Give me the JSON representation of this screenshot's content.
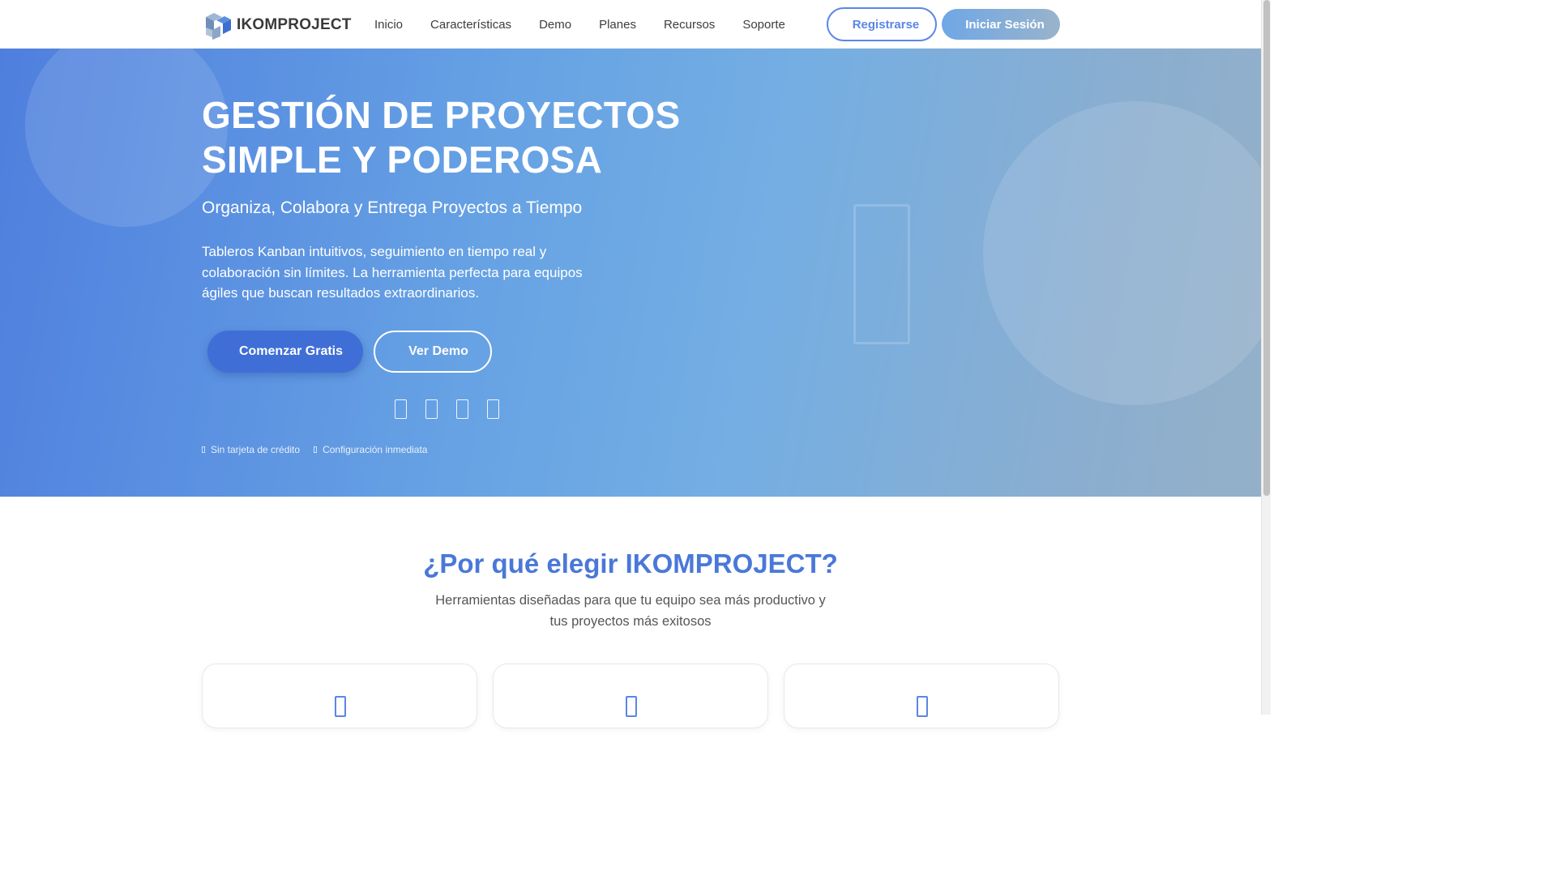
{
  "nav": {
    "brand": "IKOMPROJECT",
    "links": [
      "Inicio",
      "Características",
      "Demo",
      "Planes",
      "Recursos",
      "Soporte"
    ],
    "register_label": "Registrarse",
    "login_label": "Iniciar Sesión"
  },
  "hero": {
    "title_line1": "GESTIÓN DE PROYECTOS",
    "title_line2": "SIMPLE Y PODEROSA",
    "subtitle": "Organiza, Colabora y Entrega Proyectos a Tiempo",
    "description": "Tableros Kanban intuitivos, seguimiento en tiempo real y colaboración sin límites. La herramienta perfecta para equipos ágiles que buscan resultados extraordinarios.",
    "cta_primary": "Comenzar Gratis",
    "cta_secondary": "Ver Demo",
    "features": [
      "Sin tarjeta de crédito",
      "Configuración inmediata"
    ]
  },
  "why": {
    "title": "¿Por qué elegir IKOMPROJECT?",
    "subtitle": "Herramientas diseñadas para que tu equipo sea más productivo y tus proyectos más exitosos"
  },
  "colors": {
    "accent": "#4a78d8",
    "primary_button": "#3f6fd6",
    "hero_gradient_start": "#4f7fde",
    "hero_gradient_end": "#94b0c8"
  }
}
